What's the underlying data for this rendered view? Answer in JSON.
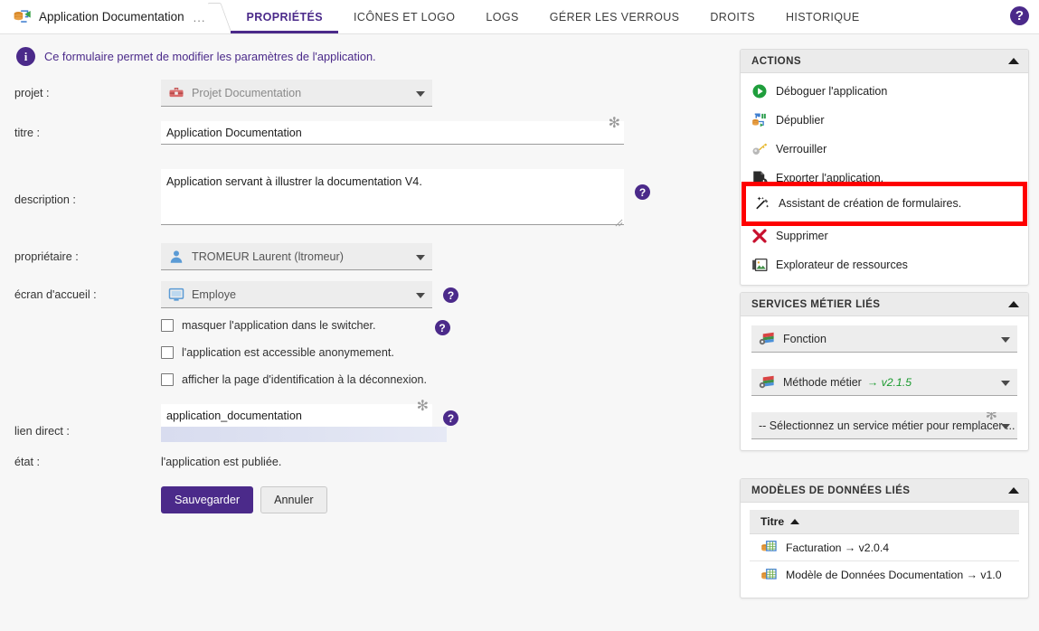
{
  "breadcrumb": {
    "app_icon": "app-database-arrow-icon",
    "title": "Application Documentation",
    "ellipsis": "..."
  },
  "tabs": [
    {
      "label": "PROPRIÉTÉS",
      "active": true
    },
    {
      "label": "ICÔNES ET LOGO",
      "active": false
    },
    {
      "label": "LOGS",
      "active": false
    },
    {
      "label": "GÉRER LES VERROUS",
      "active": false
    },
    {
      "label": "DROITS",
      "active": false
    },
    {
      "label": "HISTORIQUE",
      "active": false
    }
  ],
  "top_help_icon": "help-circle-icon",
  "info_banner": {
    "icon": "info-icon",
    "text": "Ce formulaire permet de modifier les paramètres de l'application."
  },
  "form": {
    "projet": {
      "label": "projet :",
      "value": "Projet Documentation",
      "icon": "toolbox-icon"
    },
    "titre": {
      "label": "titre :",
      "value": "Application Documentation",
      "required_mark": "✻"
    },
    "description": {
      "label": "description :",
      "value": "Application servant à illustrer la documentation V4.",
      "help_icon": "help-circle-icon"
    },
    "proprietaire": {
      "label": "propriétaire :",
      "value": "TROMEUR Laurent (ltromeur)",
      "icon": "user-icon"
    },
    "ecran_accueil": {
      "label": "écran d'accueil :",
      "value": "Employe",
      "icon": "monitor-icon",
      "help_icon": "help-circle-icon"
    },
    "checkboxes": [
      {
        "label": "masquer l'application dans le switcher.",
        "checked": false,
        "help_icon": "help-circle-icon"
      },
      {
        "label": "l'application est accessible anonymement.",
        "checked": false,
        "help_icon": ""
      },
      {
        "label": "afficher la page d'identification à la déconnexion.",
        "checked": false,
        "help_icon": ""
      }
    ],
    "lien_direct": {
      "label": "lien direct :",
      "value": "application_documentation",
      "required_mark": "✻",
      "help_icon": "help-circle-icon"
    },
    "etat": {
      "label": "état :",
      "value": "l'application est publiée."
    },
    "buttons": {
      "save": "Sauvegarder",
      "cancel": "Annuler"
    }
  },
  "panels": {
    "actions": {
      "title": "ACTIONS",
      "collapse_icon": "chevron-up-icon",
      "items": [
        {
          "label": "Déboguer l'application",
          "icon": "play-circle-green-icon"
        },
        {
          "label": "Dépublier",
          "icon": "unpublish-icon"
        },
        {
          "label": "Verrouiller",
          "icon": "key-icon"
        },
        {
          "label": "Exporter l'application.",
          "icon": "export-icon"
        },
        {
          "label": "Assistant de création de formulaires.",
          "icon": "magic-wand-icon",
          "highlighted": true
        },
        {
          "label": "Supprimer",
          "icon": "delete-x-icon"
        },
        {
          "label": "Explorateur de ressources",
          "icon": "resource-explorer-icon"
        }
      ]
    },
    "services": {
      "title": "SERVICES MÉTIER LIÉS",
      "collapse_icon": "chevron-up-icon",
      "items": [
        {
          "label": "Fonction",
          "version": "",
          "icon": "business-service-icon"
        },
        {
          "label": "Méthode métier",
          "version": "→ v2.1.5",
          "icon": "business-service-icon"
        }
      ],
      "replace_select": {
        "value": "-- Sélectionnez un service métier pour remplacer ...",
        "required_mark": "✻"
      }
    },
    "models": {
      "title": "MODÈLES DE DONNÉES LIÉS",
      "collapse_icon": "chevron-up-icon",
      "column_header": "Titre",
      "sort_icon": "sort-asc-icon",
      "rows": [
        {
          "label": "Facturation → v2.0.4",
          "icon": "data-model-icon"
        },
        {
          "label": "Modèle de Données Documentation → v1.0",
          "icon": "data-model-icon"
        }
      ]
    }
  },
  "highlight": {
    "color": "#fe0000",
    "target": "Assistant de création de formulaires."
  },
  "colors": {
    "accent": "#4b2a8a",
    "page_bg": "#f7f7f7",
    "panel_bg": "#ffffff",
    "version_green": "#1a9a2e"
  }
}
